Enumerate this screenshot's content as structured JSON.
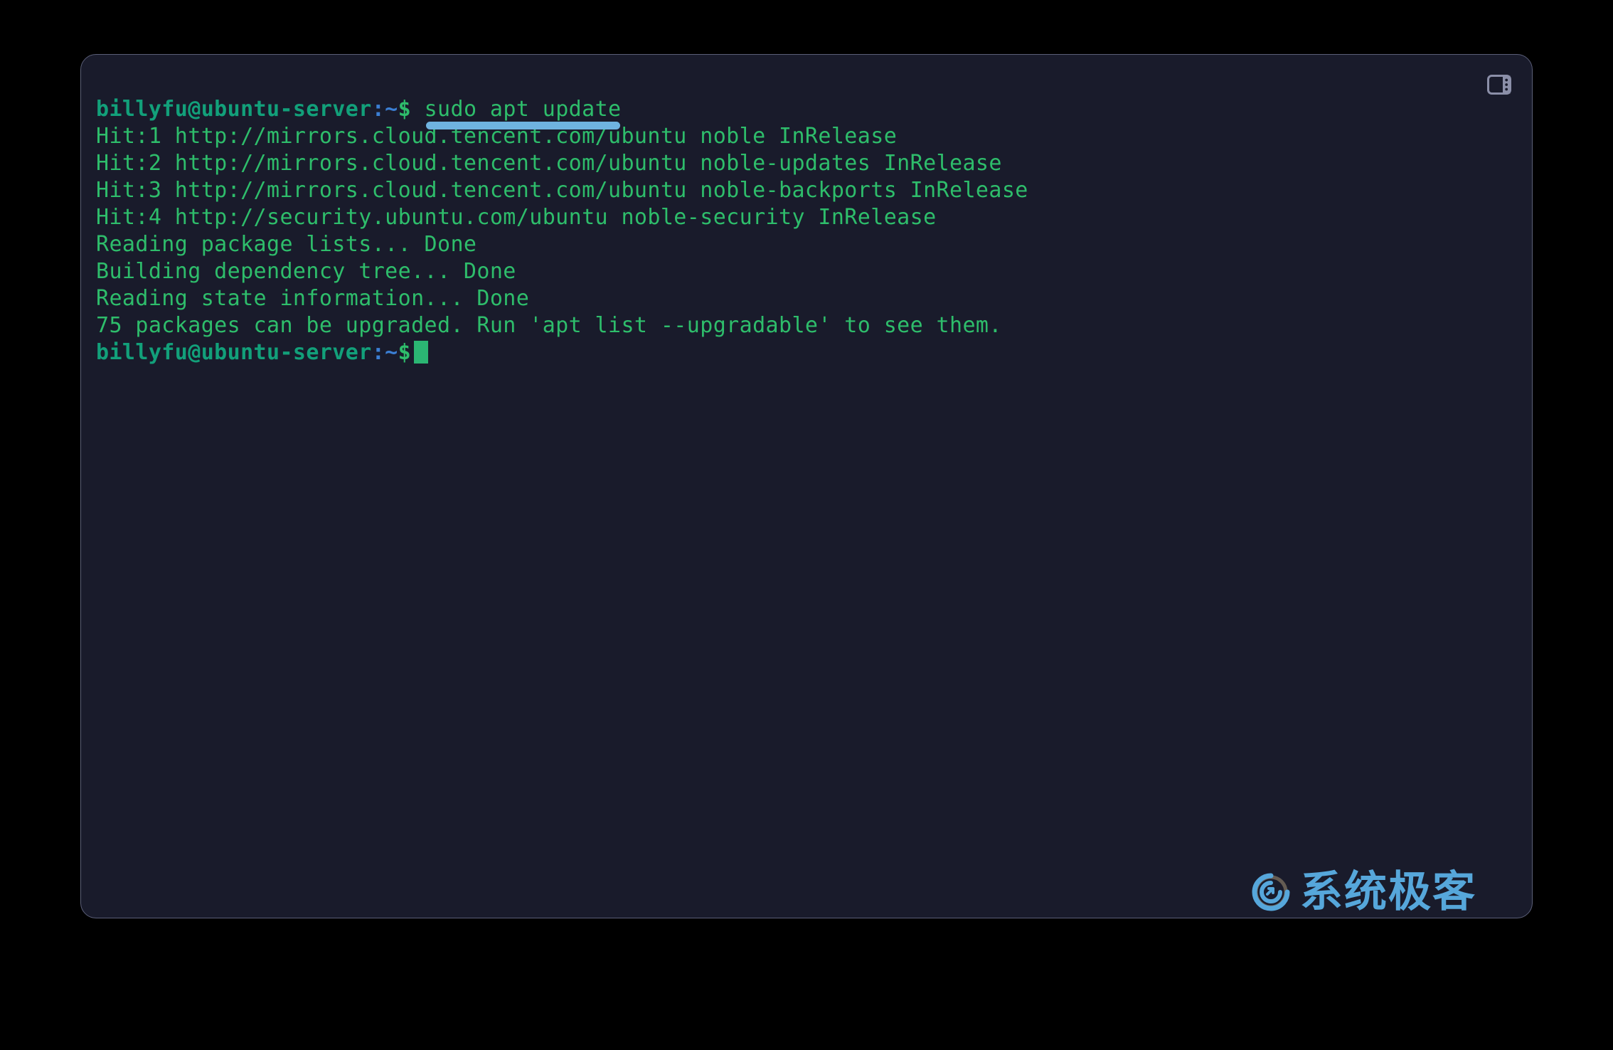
{
  "window": {
    "background_color": "#191b2b",
    "border_color": "#5b5f78",
    "outer_background": "#000000"
  },
  "titlebar": {
    "panel_toggle_icon": "layout-panel-icon",
    "panel_toggle_color": "#8b8fa8"
  },
  "terminal": {
    "prompt": {
      "user_host": "billyfu@ubuntu-server",
      "colon": ":",
      "path": "~",
      "symbol": "$"
    },
    "command": "sudo apt update",
    "command_highlight_color": "#6fb3e0",
    "text_color": "#2ebd6b",
    "prompt_color": "#12a07a",
    "path_color": "#3b7fd4",
    "cursor_color": "#2bb673",
    "output_lines": [
      "Hit:1 http://mirrors.cloud.tencent.com/ubuntu noble InRelease",
      "Hit:2 http://mirrors.cloud.tencent.com/ubuntu noble-updates InRelease",
      "Hit:3 http://mirrors.cloud.tencent.com/ubuntu noble-backports InRelease",
      "Hit:4 http://security.ubuntu.com/ubuntu noble-security InRelease",
      "Reading package lists... Done",
      "Building dependency tree... Done",
      "Reading state information... Done",
      "75 packages can be upgraded. Run 'apt list --upgradable' to see them."
    ]
  },
  "watermark": {
    "text": "系统极客",
    "color": "#5cb3ea",
    "logo_icon": "spiral-circle-logo"
  }
}
